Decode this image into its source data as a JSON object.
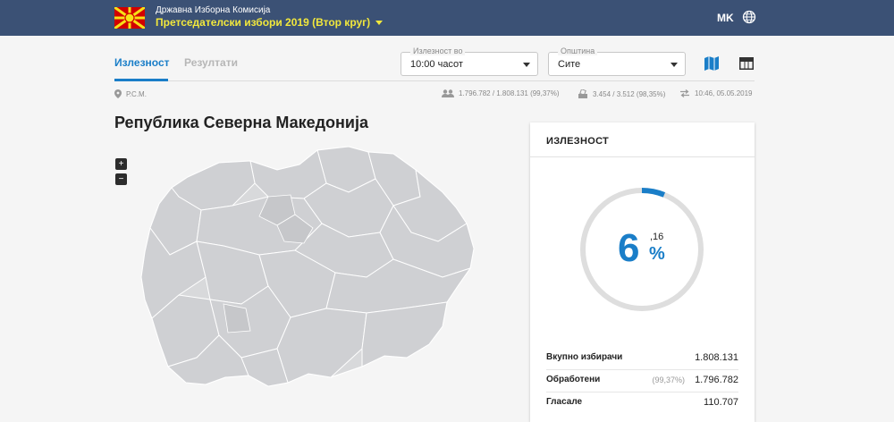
{
  "header": {
    "org_name": "Државна Изборна Комисија",
    "election": "Претседателски избори 2019 (Втор круг)",
    "language": "MK",
    "icons": {
      "logo": "macedonia-flag-logo",
      "globe": "globe-icon"
    },
    "colors": {
      "bar": "#3b5175",
      "election_text": "#f2e83c"
    }
  },
  "tabs": [
    {
      "label": "Излезност",
      "active": true
    },
    {
      "label": "Резултати",
      "active": false
    }
  ],
  "filters": {
    "turnout_at": {
      "label": "Излезност во",
      "value": "10:00 часот"
    },
    "municipality": {
      "label": "Општина",
      "value": "Сите"
    }
  },
  "view_toggles": {
    "map_icon": "map-icon",
    "table_icon": "table-icon",
    "accent": "#1a7ec8"
  },
  "info": {
    "location": "Р.С.М.",
    "voters": "1.796.782 / 1.808.131 (99,37%)",
    "stations": "3.454 / 3.512 (98,35%)",
    "updated": "10:46, 05.05.2019"
  },
  "region_title": "Република Северна Македонија",
  "zoom": {
    "in": "+",
    "out": "−"
  },
  "turnout_card": {
    "title": "ИЗЛЕЗНОСТ",
    "percent_int": "6",
    "percent_dec": ",16",
    "percent_sign": "%",
    "percent_value": 6.16,
    "rows": {
      "total": {
        "label": "Вкупно избирачи",
        "value": "1.808.131"
      },
      "processed": {
        "label": "Обработени",
        "sub": "(99,37%)",
        "value": "1.796.782"
      },
      "voted": {
        "label": "Гласале",
        "value": "110.707"
      }
    }
  }
}
